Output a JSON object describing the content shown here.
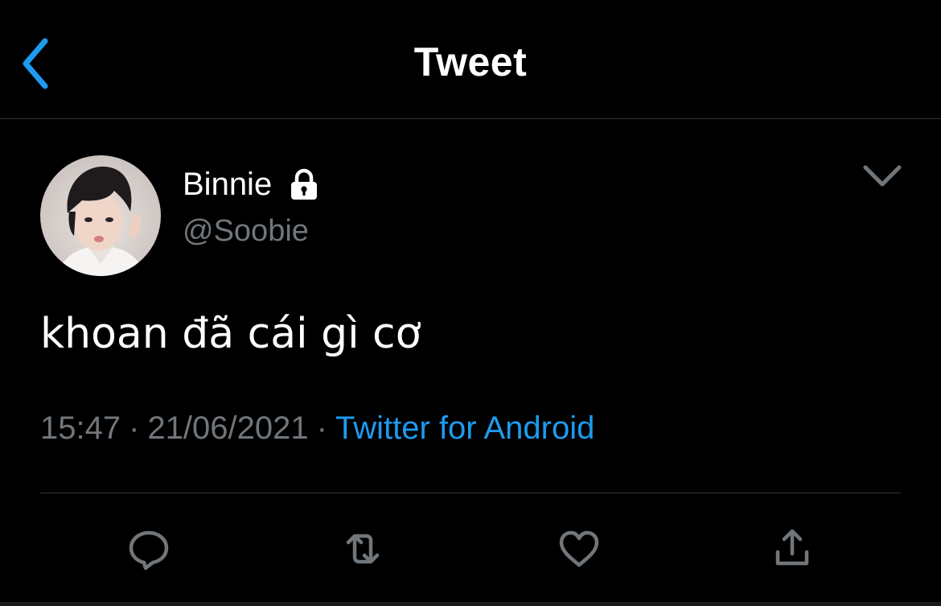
{
  "header": {
    "title": "Tweet",
    "back_icon": "chevron-left-icon"
  },
  "tweet": {
    "author": {
      "display_name": "Binnie",
      "handle": "@Soobie",
      "protected_icon": "lock-icon",
      "avatar": "avatar-photo"
    },
    "menu_icon": "chevron-down-icon",
    "text": "khoan đã cái gì cơ",
    "meta": {
      "time": "15:47",
      "separator": "·",
      "date": "21/06/2021",
      "source": "Twitter for Android"
    },
    "actions": [
      {
        "name": "reply",
        "icon": "reply-icon"
      },
      {
        "name": "retweet",
        "icon": "retweet-icon"
      },
      {
        "name": "like",
        "icon": "heart-icon"
      },
      {
        "name": "share",
        "icon": "share-icon"
      }
    ]
  },
  "colors": {
    "background": "#000000",
    "text": "#ffffff",
    "secondary": "#71767b",
    "accent": "#1d9bf0",
    "divider": "#2f3336"
  }
}
